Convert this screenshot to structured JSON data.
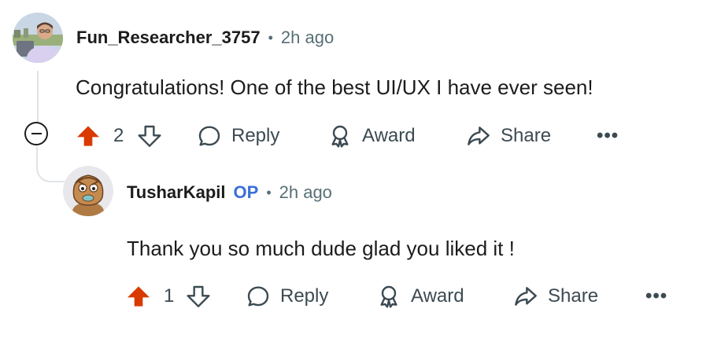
{
  "comments": [
    {
      "username": "Fun_Researcher_3757",
      "op_tag": "",
      "separator": "•",
      "time": "2h ago",
      "body": "Congratulations! One of the best UI/UX I have ever seen!",
      "votes": "2",
      "upvoted": true,
      "actions": {
        "reply": "Reply",
        "award": "Award",
        "share": "Share",
        "more": "•••"
      }
    },
    {
      "username": "TusharKapil",
      "op_tag": "OP",
      "separator": "•",
      "time": "2h ago",
      "body": "Thank you so much dude glad you liked it !",
      "votes": "1",
      "upvoted": true,
      "actions": {
        "reply": "Reply",
        "award": "Award",
        "share": "Share",
        "more": "•••"
      }
    }
  ],
  "colors": {
    "upvote": "#d93a00",
    "op_tag": "#3b6fd8",
    "secondary_text": "#576f76",
    "thread_line": "#e0e3e6"
  },
  "icons": [
    "upvote-icon",
    "downvote-icon",
    "reply-icon",
    "award-icon",
    "share-icon",
    "more-icon",
    "collapse-icon"
  ]
}
